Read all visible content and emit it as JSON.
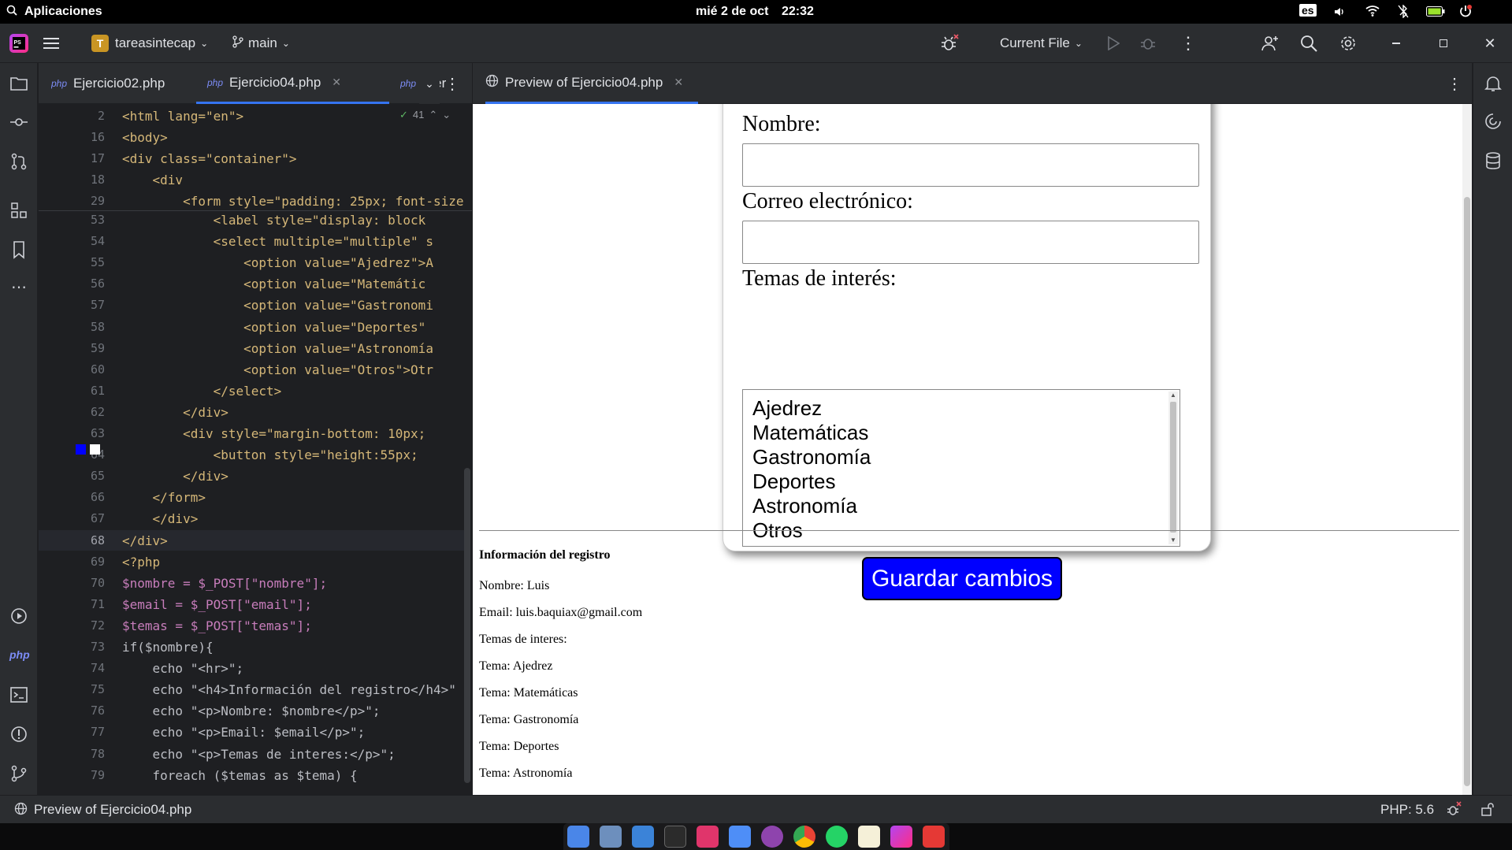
{
  "system_bar": {
    "apps": "Aplicaciones",
    "date": "mié 2 de oct",
    "time": "22:32",
    "keyboard": "es"
  },
  "title_bar": {
    "project_letter": "T",
    "project": "tareasintecap",
    "branch": "main",
    "run_config": "Current File"
  },
  "editor": {
    "tabs": [
      {
        "badge": "php",
        "label": "Ejercicio02.php"
      },
      {
        "badge": "php",
        "label": "Ejercicio04.php"
      },
      {
        "badge": "php",
        "label": "Ejer"
      }
    ],
    "inspection_count": "41",
    "sticky_lines": [
      {
        "num": "2",
        "code": "<html lang=\"en\">"
      },
      {
        "num": "16",
        "code": "<body>"
      },
      {
        "num": "17",
        "code": "<div class=\"container\">"
      },
      {
        "num": "18",
        "code": "    <div"
      },
      {
        "num": "29",
        "code": "        <form style=\"padding: 25px; font-size"
      }
    ],
    "lines": [
      {
        "num": "53",
        "code": "            <label style=\"display: block"
      },
      {
        "num": "54",
        "code": "            <select multiple=\"multiple\" s"
      },
      {
        "num": "55",
        "code": "                <option value=\"Ajedrez\">A"
      },
      {
        "num": "56",
        "code": "                <option value=\"Matemátic"
      },
      {
        "num": "57",
        "code": "                <option value=\"Gastronomi"
      },
      {
        "num": "58",
        "code": "                <option value=\"Deportes\""
      },
      {
        "num": "59",
        "code": "                <option value=\"Astronomía"
      },
      {
        "num": "60",
        "code": "                <option value=\"Otros\">Otr"
      },
      {
        "num": "61",
        "code": "            </select>"
      },
      {
        "num": "62",
        "code": "        </div>"
      },
      {
        "num": "63",
        "code": "        <div style=\"margin-bottom: 10px;"
      },
      {
        "num": "64",
        "code": "            <button style=\"height:55px; "
      },
      {
        "num": "65",
        "code": "        </div>"
      },
      {
        "num": "66",
        "code": "    </form>"
      },
      {
        "num": "67",
        "code": "    </div>"
      },
      {
        "num": "68",
        "code": "</div>"
      },
      {
        "num": "69",
        "code": "<?php"
      },
      {
        "num": "70",
        "code": "$nombre = $_POST[\"nombre\"];"
      },
      {
        "num": "71",
        "code": "$email = $_POST[\"email\"];"
      },
      {
        "num": "72",
        "code": "$temas = $_POST[\"temas\"];"
      },
      {
        "num": "73",
        "code": "if($nombre){"
      },
      {
        "num": "74",
        "code": "    echo \"<hr>\";"
      },
      {
        "num": "75",
        "code": "    echo \"<h4>Información del registro</h4>\""
      },
      {
        "num": "76",
        "code": "    echo \"<p>Nombre: $nombre</p>\";"
      },
      {
        "num": "77",
        "code": "    echo \"<p>Email: $email</p>\";"
      },
      {
        "num": "78",
        "code": "    echo \"<p>Temas de interes:</p>\";"
      },
      {
        "num": "79",
        "code": "    foreach ($temas as $tema) {"
      }
    ]
  },
  "preview": {
    "tab_label": "Preview of Ejercicio04.php",
    "form": {
      "name_label": "Nombre:",
      "email_label": "Correo electrónico:",
      "topics_label": "Temas de interés:",
      "options": [
        "Ajedrez",
        "Matemáticas",
        "Gastronomía",
        "Deportes",
        "Astronomía",
        "Otros"
      ],
      "save_button": "Guardar cambios"
    },
    "output": {
      "heading": "Información del registro",
      "name": "Nombre: Luis",
      "email": "Email: luis.baquiax@gmail.com",
      "topics_header": "Temas de interes:",
      "topics": [
        "Tema: Ajedrez",
        "Tema: Matemáticas",
        "Tema: Gastronomía",
        "Tema: Deportes",
        "Tema: Astronomía"
      ]
    }
  },
  "status_bar": {
    "left": "Preview of Ejercicio04.php",
    "php_version": "PHP: 5.6"
  },
  "colors": {
    "accent": "#3574f0",
    "button_blue": "#0000ff",
    "editor_bg": "#1e1f22",
    "panel_bg": "#2b2d30"
  }
}
